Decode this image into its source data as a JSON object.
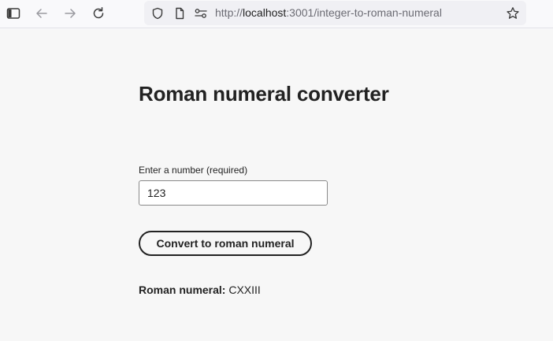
{
  "browser": {
    "url_scheme": "http://",
    "url_host": "localhost",
    "url_rest": ":3001/integer-to-roman-numeral",
    "icons": [
      "sidebar-icon",
      "back-icon",
      "forward-icon",
      "reload-icon",
      "shield-icon",
      "page-icon",
      "permissions-icon",
      "bookmark-star-icon"
    ]
  },
  "page": {
    "title": "Roman numeral converter",
    "input_label": "Enter a number (required)",
    "input_value": "123",
    "convert_button": "Convert to roman numeral",
    "result_label": "Roman numeral:",
    "result_value": "CXXIII"
  }
}
